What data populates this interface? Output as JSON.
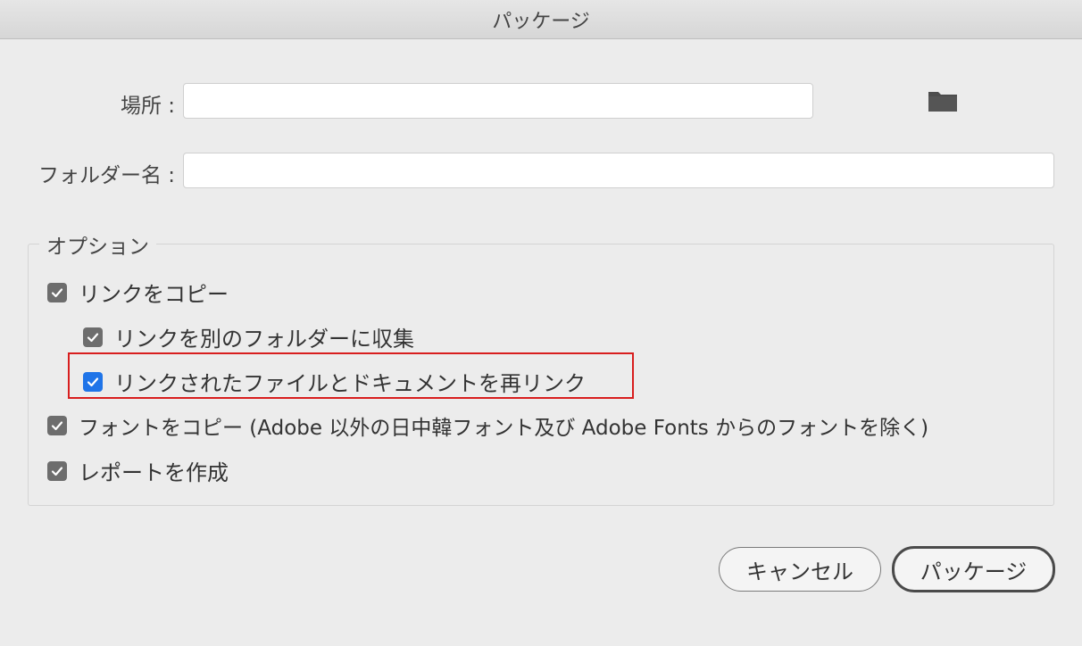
{
  "window": {
    "title": "パッケージ"
  },
  "form": {
    "location_label": "場所 :",
    "location_value": "",
    "location_placeholder": "",
    "folder_name_label": "フォルダー名 :",
    "folder_name_value": "",
    "folder_name_placeholder": "",
    "browse_icon": "folder-icon"
  },
  "options": {
    "title": "オプション",
    "items": [
      {
        "label": "リンクをコピー",
        "checked": true,
        "color": "#6d6d6d"
      },
      {
        "label": "リンクを別のフォルダーに収集",
        "checked": true,
        "color": "#6d6d6d"
      },
      {
        "label": "リンクされたファイルとドキュメントを再リンク",
        "checked": true,
        "color": "#1f74e8",
        "highlighted": true
      },
      {
        "label": "フォントをコピー (Adobe 以外の日中韓フォント及び Adobe Fonts からのフォントを除く)",
        "checked": true,
        "color": "#6d6d6d"
      },
      {
        "label": "レポートを作成",
        "checked": true,
        "color": "#6d6d6d"
      }
    ]
  },
  "buttons": {
    "cancel_label": "キャンセル",
    "package_label": "パッケージ"
  },
  "colors": {
    "highlight_border": "#d81e1e",
    "checkbox_default": "#6d6d6d",
    "checkbox_focused": "#1f74e8",
    "background": "#ececec"
  }
}
